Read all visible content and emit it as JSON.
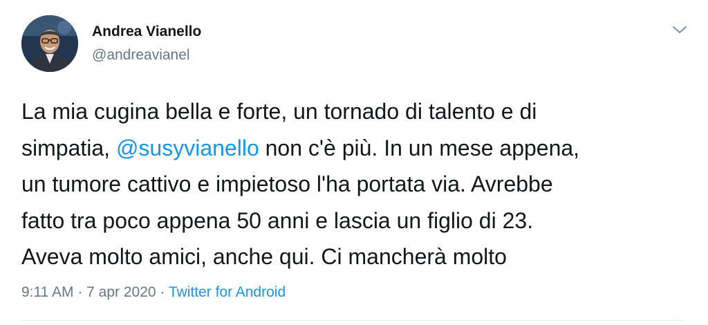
{
  "author": {
    "name": "Andrea Vianello",
    "handle": "@andreavianel"
  },
  "tweet": {
    "line1": "La mia cugina bella e forte, un tornado di talento e di",
    "line2_before": "simpatia, ",
    "mention": "@susyvianello",
    "line2_after": " non c'è più. In un mese appena,",
    "line3": "un tumore cattivo e impietoso l'ha portata via. Avrebbe",
    "line4": "fatto tra poco appena 50 anni e lascia un figlio di 23.",
    "line5": "Aveva molto amici, anche qui. Ci mancherà molto"
  },
  "meta": {
    "time": "9:11 AM",
    "sep1": " · ",
    "date": "7 apr 2020",
    "sep2": " · ",
    "source": "Twitter for Android"
  },
  "icons": {
    "menu": "chevron-down-icon"
  },
  "colors": {
    "link": "#1b95e0",
    "secondary_text": "#657786",
    "primary_text": "#14171a"
  }
}
